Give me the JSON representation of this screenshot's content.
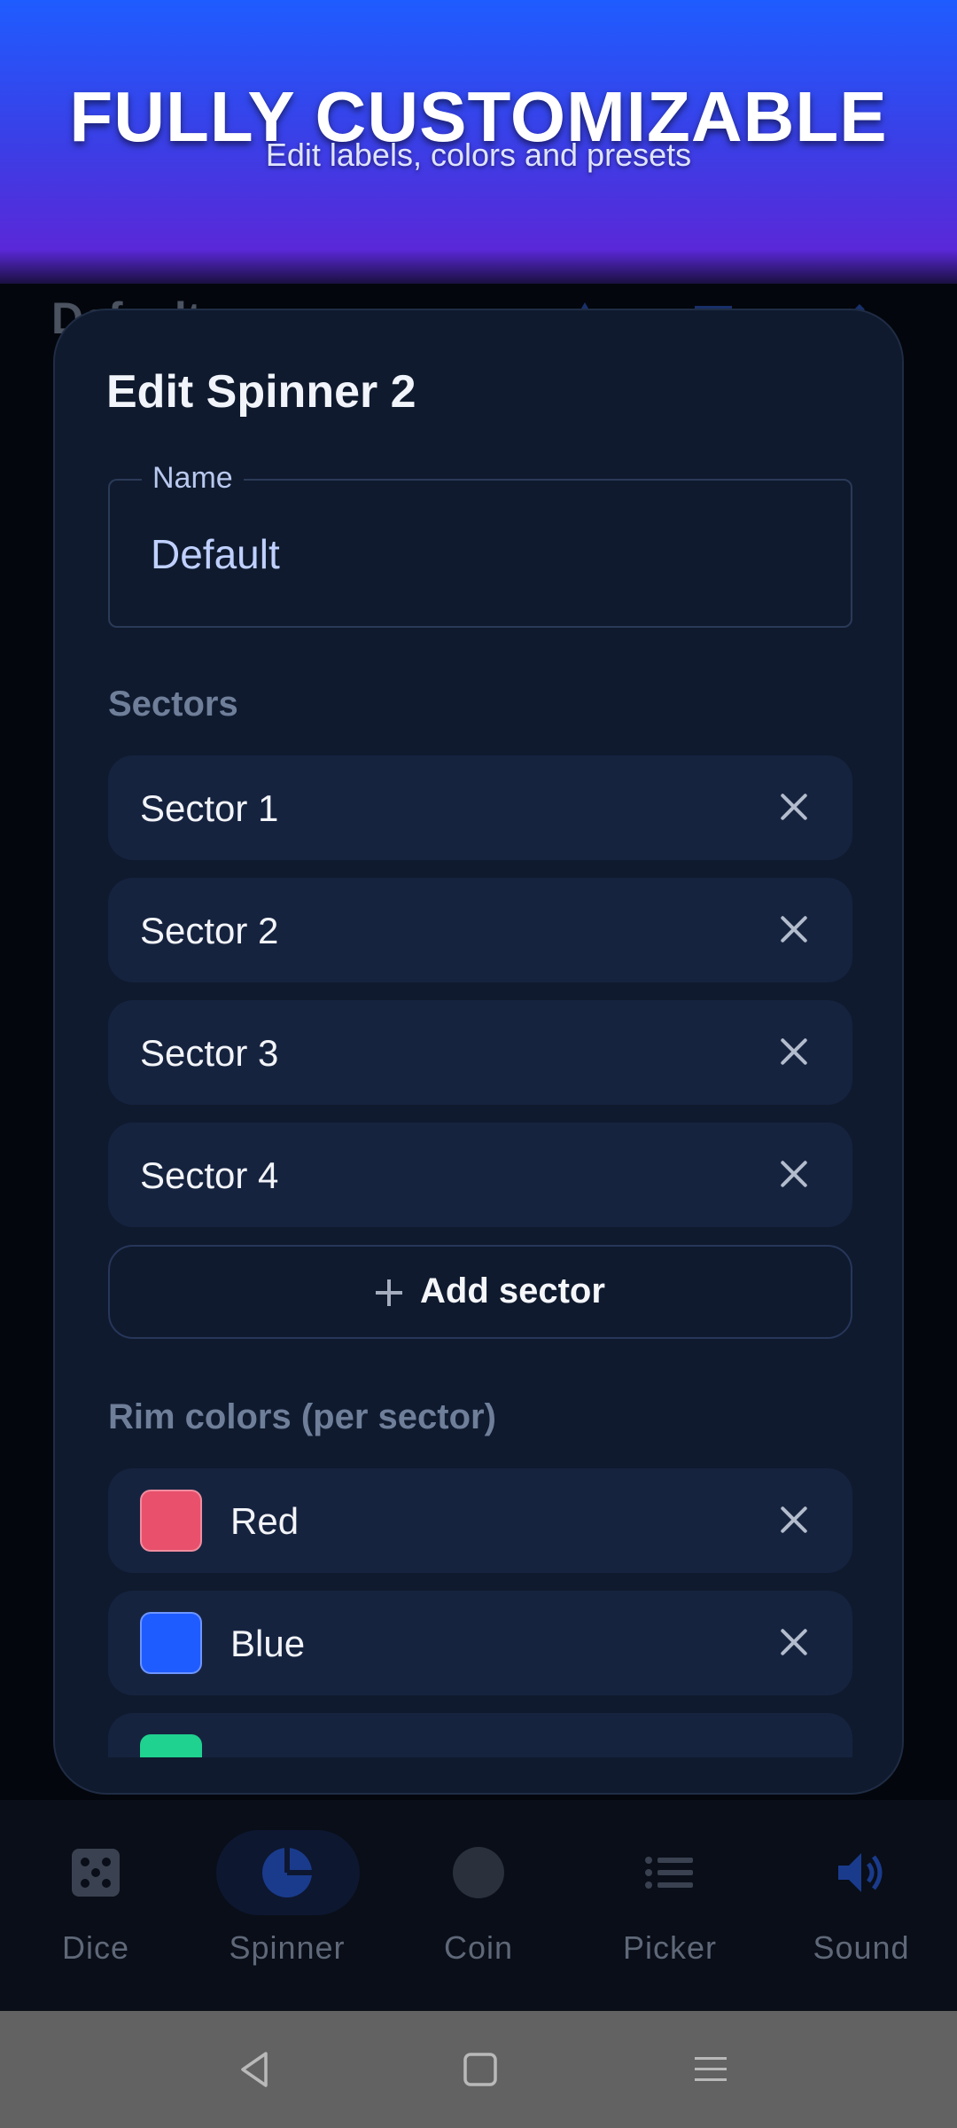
{
  "promo": {
    "title": "FULLY CUSTOMIZABLE",
    "subtitle": "Edit labels, colors and presets"
  },
  "background": {
    "title": "Default"
  },
  "dialog": {
    "title": "Edit Spinner 2",
    "name_field": {
      "label": "Name",
      "value": "Default"
    },
    "sectors_label": "Sectors",
    "sectors": [
      {
        "label": "Sector 1"
      },
      {
        "label": "Sector 2"
      },
      {
        "label": "Sector 3"
      },
      {
        "label": "Sector 4"
      }
    ],
    "add_sector_label": "Add sector",
    "rim_colors_label": "Rim colors (per sector)",
    "rim_colors": [
      {
        "label": "Red",
        "color": "#e8506c"
      },
      {
        "label": "Blue",
        "color": "#1f5cff"
      }
    ],
    "partial_rim_color": "#1fd28f"
  },
  "bottom_nav": {
    "items": [
      {
        "label": "Dice",
        "icon": "dice-icon"
      },
      {
        "label": "Spinner",
        "icon": "spinner-icon"
      },
      {
        "label": "Coin",
        "icon": "coin-icon"
      },
      {
        "label": "Picker",
        "icon": "list-icon"
      },
      {
        "label": "Sound",
        "icon": "volume-icon"
      }
    ],
    "active": "Spinner"
  },
  "system_nav": {
    "buttons": [
      "back-icon",
      "home-icon",
      "menu-icon"
    ]
  },
  "colors": {
    "accent": "#1f5cff",
    "dialog_bg": "#0f1a2e",
    "row_bg": "#16233f"
  }
}
